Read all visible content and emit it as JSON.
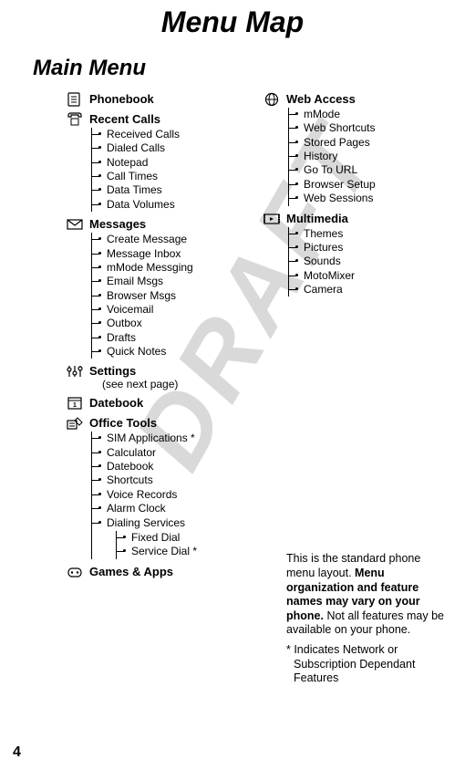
{
  "title": "Menu Map",
  "sectionTitle": "Main Menu",
  "pageNumber": "4",
  "watermark": "DRAFT",
  "left": {
    "phonebook": {
      "label": "Phonebook"
    },
    "recentCalls": {
      "label": "Recent Calls",
      "items": [
        "Received Calls",
        "Dialed Calls",
        "Notepad",
        "Call Times",
        "Data Times",
        "Data Volumes"
      ]
    },
    "messages": {
      "label": "Messages",
      "items": [
        "Create Message",
        "Message Inbox",
        "mMode Messging",
        "Email Msgs",
        "Browser Msgs",
        "Voicemail",
        "Outbox",
        "Drafts",
        "Quick Notes"
      ]
    },
    "settings": {
      "label": "Settings",
      "note": "(see next page)"
    },
    "datebook": {
      "label": "Datebook"
    },
    "officeTools": {
      "label": "Office Tools",
      "items": [
        "SIM Applications *",
        "Calculator",
        "Datebook",
        "Shortcuts",
        "Voice Records",
        "Alarm Clock"
      ],
      "dialingServices": {
        "label": "Dialing Services",
        "items": [
          "Fixed Dial",
          "Service Dial *"
        ]
      }
    },
    "gamesApps": {
      "label": "Games & Apps"
    }
  },
  "right": {
    "webAccess": {
      "label": "Web Access",
      "items": [
        "mMode",
        "Web Shortcuts",
        "Stored Pages",
        "History",
        "Go To URL",
        "Browser Setup",
        "Web Sessions"
      ]
    },
    "multimedia": {
      "label": "Multimedia",
      "items": [
        "Themes",
        "Pictures",
        "Sounds",
        "MotoMixer",
        "Camera"
      ]
    }
  },
  "note": {
    "part1": "This is the standard phone menu layout. ",
    "boldPart": "Menu organization and feature names may vary on your phone.",
    "part2": " Not all features may be available on your phone.",
    "asteriskNote": "* Indicates Network or Subscription Dependant Features"
  }
}
